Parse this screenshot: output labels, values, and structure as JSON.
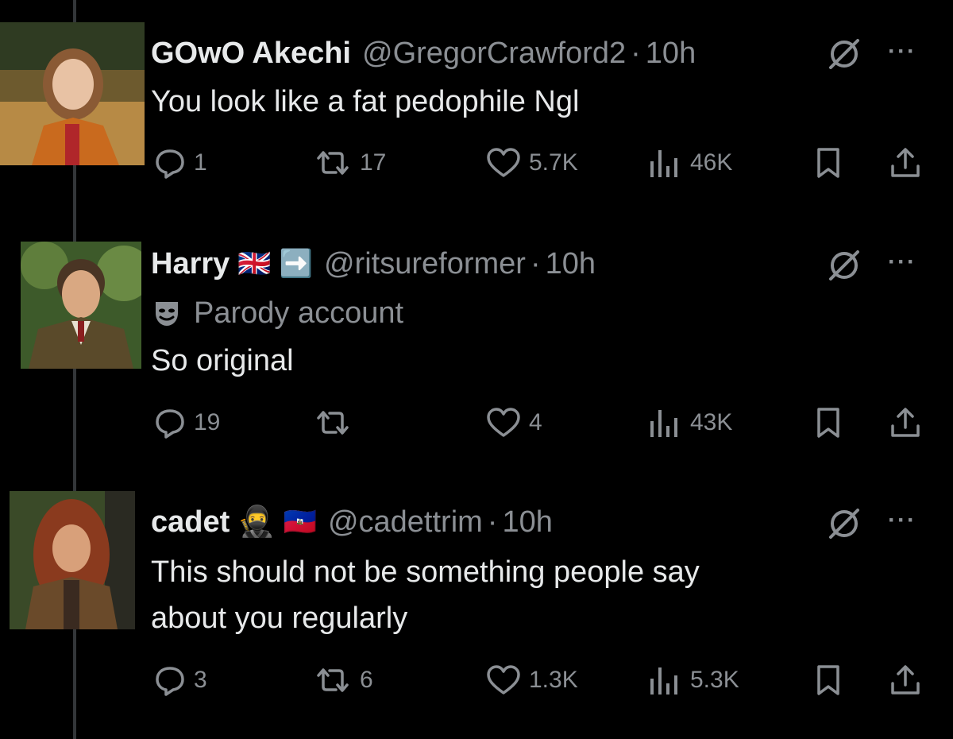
{
  "tweets": [
    {
      "name": "GOwO Akechi",
      "handle": "@GregorCrawford2",
      "dot": "·",
      "time": "10h",
      "text": "You look like a fat pedophile Ngl",
      "replies": "1",
      "reposts": "17",
      "likes": "5.7K",
      "views": "46K"
    },
    {
      "name": "Harry",
      "name_emojis": [
        "🇬🇧",
        "➡️"
      ],
      "handle": "@ritsureformer",
      "dot": "·",
      "time": "10h",
      "parody_label": "Parody account",
      "text": "So original",
      "replies": "19",
      "reposts": "",
      "likes": "4",
      "views": "43K"
    },
    {
      "name": "cadet",
      "name_emojis": [
        "🥷",
        "🇭🇹"
      ],
      "handle": "@cadettrim",
      "dot": "·",
      "time": "10h",
      "text_line1": "This should not be something people say",
      "text_line2": "about you regularly",
      "replies": "3",
      "reposts": "6",
      "likes": "1.3K",
      "views": "5.3K"
    }
  ],
  "more_glyph": "···",
  "colors": {
    "background": "#000000",
    "text": "#e7e9ea",
    "secondary": "#8b8f94",
    "thread_line": "#333639"
  },
  "icons": [
    "reply-icon",
    "repost-icon",
    "like-icon",
    "views-icon",
    "bookmark-icon",
    "share-icon",
    "grok-icon",
    "more-icon",
    "parody-mask-icon"
  ]
}
